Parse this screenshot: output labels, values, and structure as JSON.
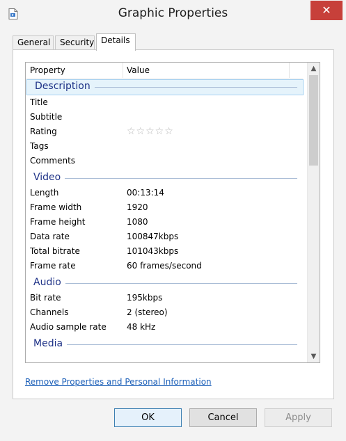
{
  "window": {
    "title": "Graphic Properties",
    "close_glyph": "✕",
    "icon": "media-file-icon",
    "close_color": "#c7403a"
  },
  "tabs": [
    {
      "label": "General"
    },
    {
      "label": "Security"
    },
    {
      "label": "Details",
      "active": true
    }
  ],
  "table": {
    "col_property": "Property",
    "col_value": "Value",
    "groups": [
      {
        "title": "Description",
        "selected": true,
        "rows": [
          {
            "name": "Title",
            "value": ""
          },
          {
            "name": "Subtitle",
            "value": ""
          },
          {
            "name": "Rating",
            "value": "",
            "stars": "☆☆☆☆☆",
            "rating": 0
          },
          {
            "name": "Tags",
            "value": ""
          },
          {
            "name": "Comments",
            "value": ""
          }
        ]
      },
      {
        "title": "Video",
        "rows": [
          {
            "name": "Length",
            "value": "00:13:14"
          },
          {
            "name": "Frame width",
            "value": "1920"
          },
          {
            "name": "Frame height",
            "value": "1080"
          },
          {
            "name": "Data rate",
            "value": "100847kbps"
          },
          {
            "name": "Total bitrate",
            "value": "101043kbps"
          },
          {
            "name": "Frame rate",
            "value": "60 frames/second"
          }
        ]
      },
      {
        "title": "Audio",
        "rows": [
          {
            "name": "Bit rate",
            "value": "195kbps"
          },
          {
            "name": "Channels",
            "value": "2 (stereo)"
          },
          {
            "name": "Audio sample rate",
            "value": "48 kHz"
          }
        ]
      },
      {
        "title": "Media",
        "rows": []
      }
    ]
  },
  "link_text": "Remove Properties and Personal Information",
  "buttons": {
    "ok": "OK",
    "cancel": "Cancel",
    "apply": "Apply"
  },
  "colors": {
    "group_title": "#1e3287",
    "link": "#1b5fb8",
    "selection": "#e5f3fb"
  }
}
